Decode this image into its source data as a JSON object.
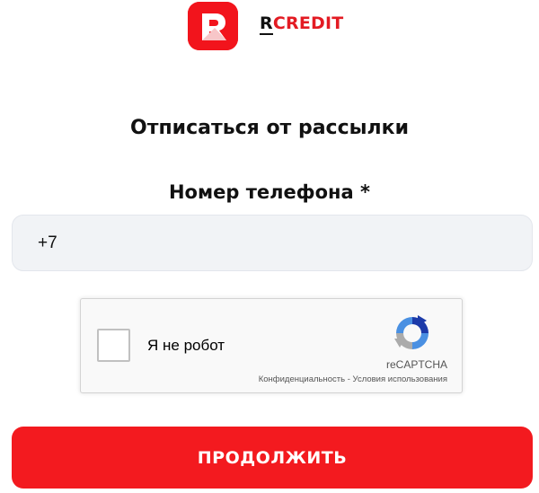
{
  "header": {
    "logo_prefix": "R",
    "logo_suffix": "CREDIT",
    "brand_color": "#f2141c"
  },
  "form": {
    "title": "Отписаться от рассылки",
    "phone_label": "Номер телефона *",
    "phone_value": "+7"
  },
  "captcha": {
    "label": "Я не робот",
    "brand": "reCAPTCHA",
    "privacy_link": "Конфиденциальность",
    "separator": " - ",
    "terms_link": "Условия использования",
    "logo_icon": "recaptcha-logo-icon",
    "checked": false
  },
  "submit": {
    "label": "ПРОДОЛЖИТЬ",
    "color": "#f31a1f"
  }
}
